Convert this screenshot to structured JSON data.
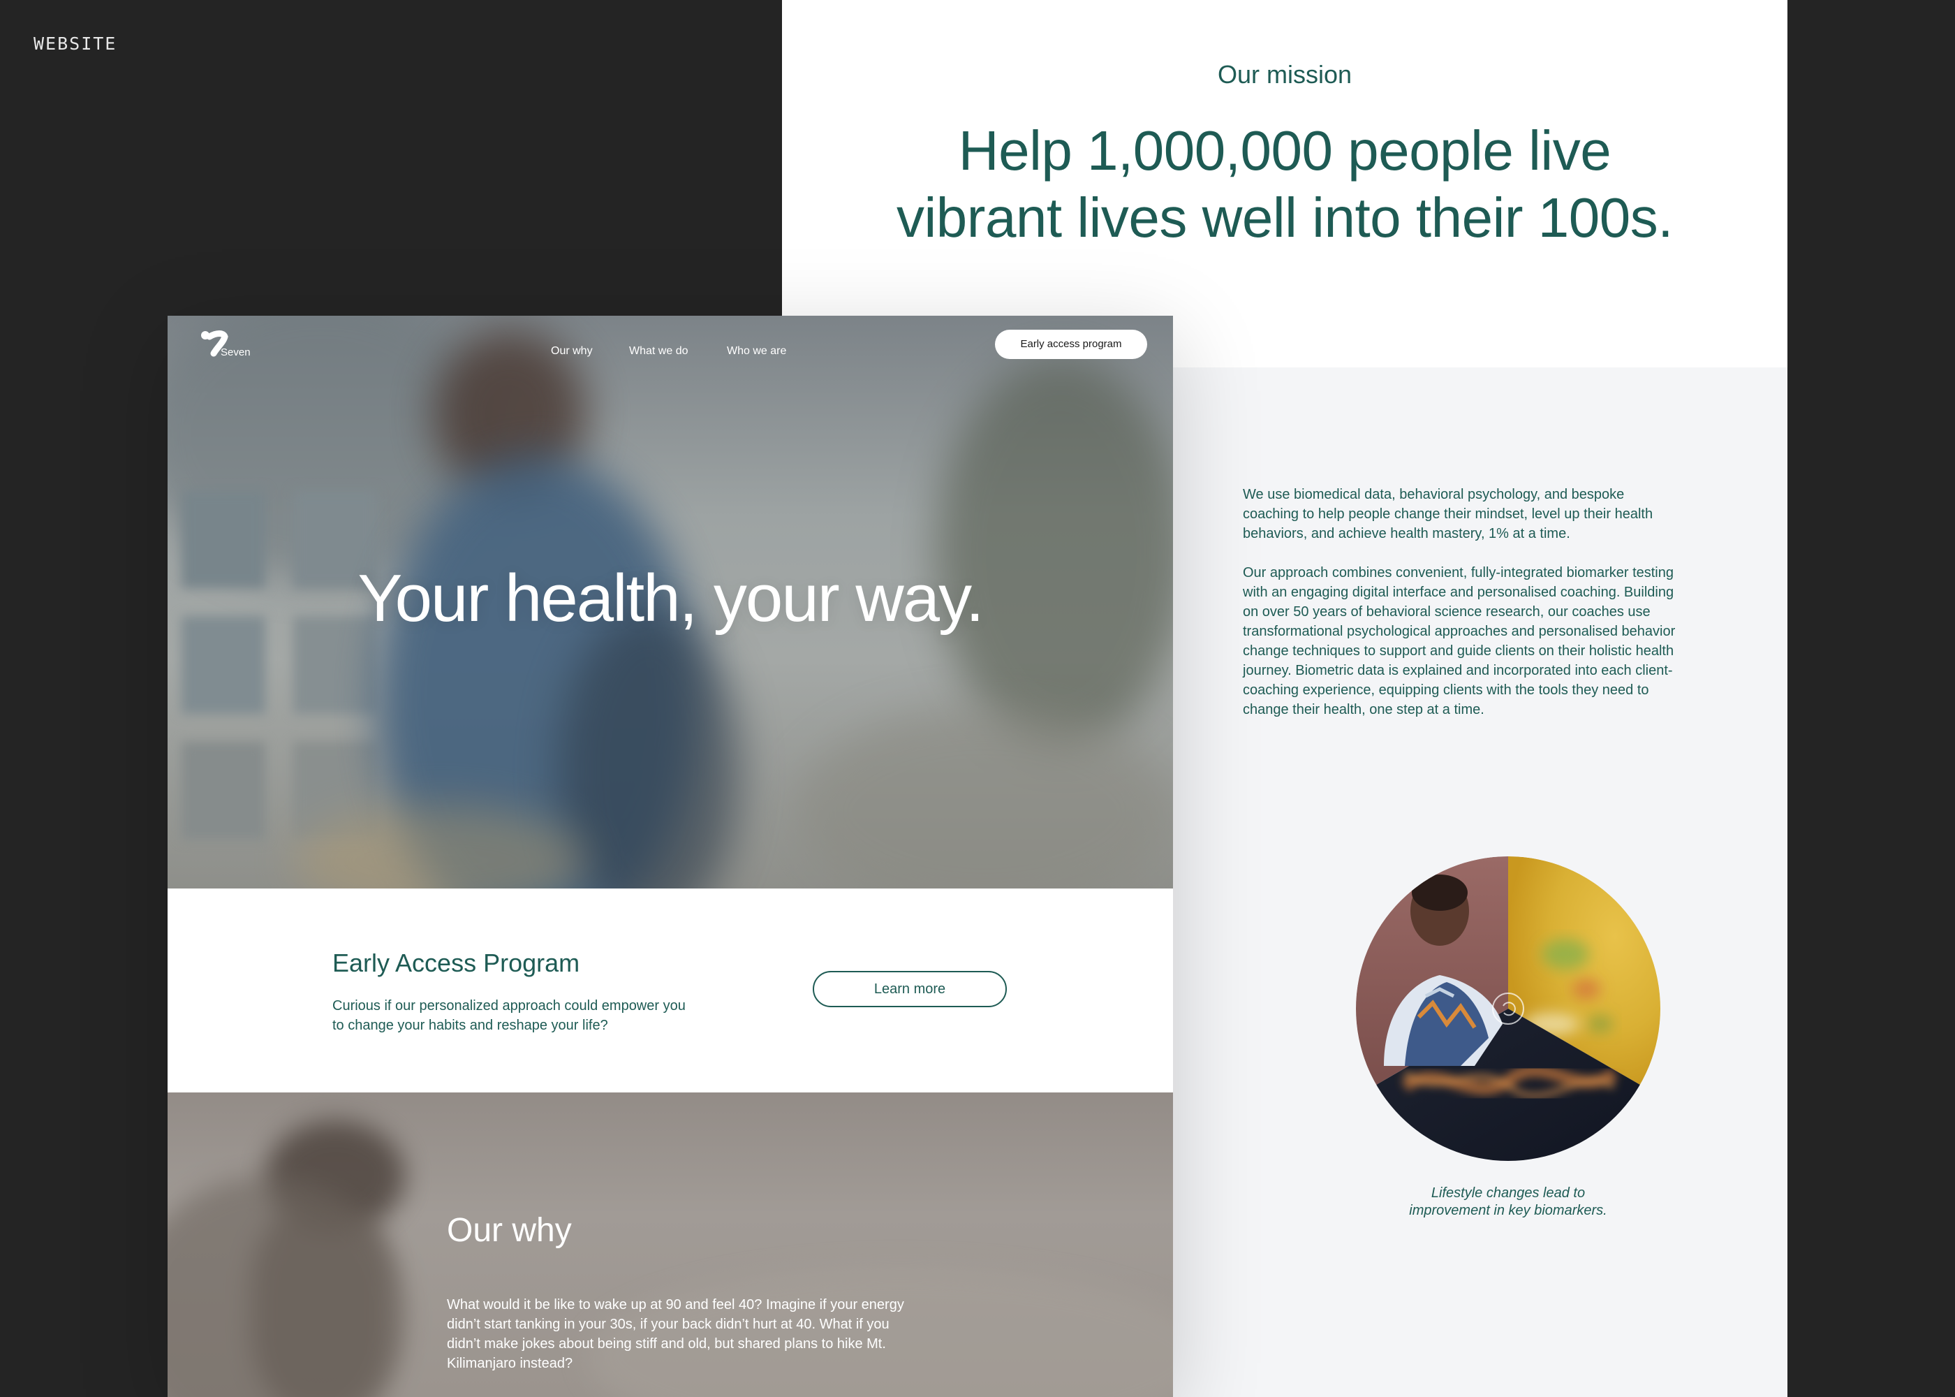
{
  "section_tag": "WEBSITE",
  "mission": {
    "eyebrow": "Our mission",
    "headline_line1": "Help 1,000,000 people live",
    "headline_line2": "vibrant lives well into their 100s.",
    "paragraph1": "We use biomedical data, behavioral psychology, and bespoke coaching to help people change their mindset, level up their health behaviors, and achieve health mastery, 1% at a time.",
    "paragraph2": "Our approach combines convenient, fully-integrated biomarker testing with an engaging digital interface and personalised coaching.  Building on over 50 years of behavioral science research, our coaches use transformational psychological approaches and personalised behavior change techniques to support and guide clients on their holistic health journey. Biometric data is explained and incorporated into each client-coaching experience, equipping clients with the tools they need to change their health, one step at a time.",
    "caption_line1": "Lifestyle changes lead to",
    "caption_line2": "improvement in key biomarkers."
  },
  "site": {
    "logo_text": "Seven",
    "nav": {
      "links": [
        "Our why",
        "What we do",
        "Who we are"
      ],
      "cta_label": "Early access program"
    },
    "hero": {
      "title": "Your health, your way."
    },
    "early_access": {
      "title": "Early Access Program",
      "description": "Curious if our personalized approach could empower you to change your habits and reshape your life?",
      "button_label": "Learn more"
    },
    "our_why": {
      "title": "Our why",
      "body": "What would it be like to wake up at 90 and feel 40? Imagine if your energy didn’t start tanking in your 30s, if your back didn’t hurt at 40. What if you didn’t make jokes about being stiff and old, but shared plans to hike Mt. Kilimanjaro instead?"
    }
  },
  "colors": {
    "brand_green": "#1e5b54",
    "background_dark": "#242424",
    "panel_light": "#f4f5f7"
  }
}
